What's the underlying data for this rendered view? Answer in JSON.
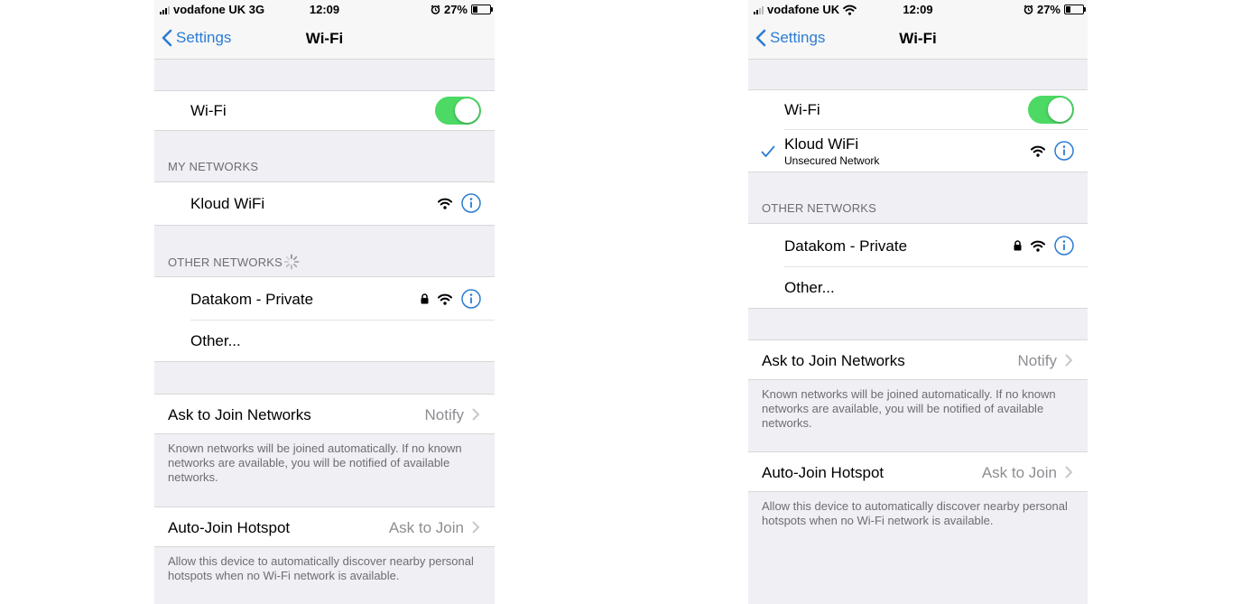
{
  "left": {
    "status": {
      "carrier": "vodafone UK 3G",
      "time": "12:09",
      "battery": "27%",
      "battery_level": 0.27
    },
    "nav": {
      "back": "Settings",
      "title": "Wi-Fi"
    },
    "wifi_label": "Wi-Fi",
    "wifi_on": true,
    "my_networks_header": "MY NETWORKS",
    "my_networks": [
      {
        "name": "Kloud WiFi"
      }
    ],
    "other_networks_header": "OTHER NETWORKS",
    "other_networks": [
      {
        "name": "Datakom - Private",
        "locked": true
      }
    ],
    "other_label": "Other...",
    "ask_join": {
      "label": "Ask to Join Networks",
      "value": "Notify"
    },
    "ask_join_note": "Known networks will be joined automatically. If no known networks are available, you will be notified of available networks.",
    "auto_join": {
      "label": "Auto-Join Hotspot",
      "value": "Ask to Join"
    },
    "auto_join_note": "Allow this device to automatically discover nearby personal hotspots when no Wi-Fi network is available."
  },
  "right": {
    "status": {
      "carrier": "vodafone UK",
      "time": "12:09",
      "battery": "27%",
      "battery_level": 0.27
    },
    "nav": {
      "back": "Settings",
      "title": "Wi-Fi"
    },
    "wifi_label": "Wi-Fi",
    "wifi_on": true,
    "connected": {
      "name": "Kloud WiFi",
      "subtitle": "Unsecured Network"
    },
    "other_networks_header": "OTHER NETWORKS",
    "other_networks": [
      {
        "name": "Datakom - Private",
        "locked": true
      }
    ],
    "other_label": "Other...",
    "ask_join": {
      "label": "Ask to Join Networks",
      "value": "Notify"
    },
    "ask_join_note": "Known networks will be joined automatically. If no known networks are available, you will be notified of available networks.",
    "auto_join": {
      "label": "Auto-Join Hotspot",
      "value": "Ask to Join"
    },
    "auto_join_note": "Allow this device to automatically discover nearby personal hotspots when no Wi-Fi network is available."
  },
  "colors": {
    "accent": "#2b7cd3",
    "toggle_on": "#4cd964",
    "secondary_text": "#8e8e93"
  },
  "icons": [
    "signal-icon",
    "wifi-icon",
    "alarm-icon",
    "battery-icon",
    "chevron-left-icon",
    "info-icon",
    "lock-icon",
    "chevron-right-icon",
    "checkmark-icon",
    "spinner-icon"
  ]
}
